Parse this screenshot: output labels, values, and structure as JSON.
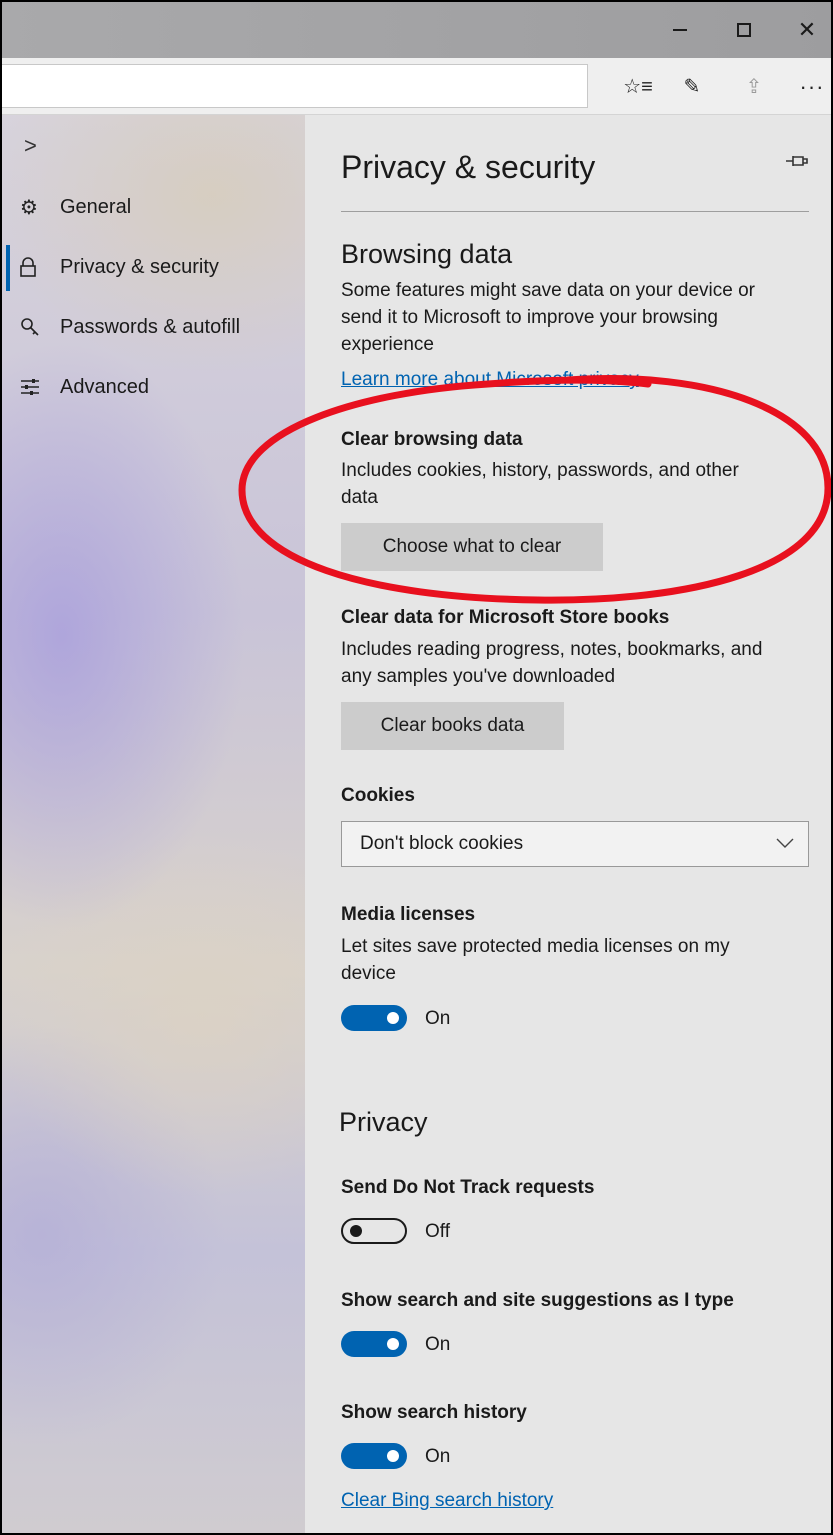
{
  "window": {
    "minimize_icon": "minimize-icon",
    "maximize_icon": "maximize-icon",
    "close_glyph": "✕"
  },
  "toolbar": {
    "favorites_glyph": "☆≡",
    "pen_glyph": "✎",
    "share_glyph": "⇪",
    "more_glyph": "···"
  },
  "sidebar": {
    "collapse_glyph": ">",
    "items": [
      {
        "label": "General",
        "icon": "gear-icon",
        "glyph": "⚙"
      },
      {
        "label": "Privacy & security",
        "icon": "lock-icon",
        "glyph": "🔒"
      },
      {
        "label": "Passwords & autofill",
        "icon": "key-icon",
        "glyph": "⚿"
      },
      {
        "label": "Advanced",
        "icon": "sliders-icon",
        "glyph": "☰"
      }
    ],
    "active_index": 1
  },
  "panel": {
    "title": "Privacy & security",
    "pin_glyph": "⊣⊏",
    "browsing_data": {
      "heading": "Browsing data",
      "description_lines": [
        "Some features might save data on your device or",
        "send it to Microsoft to improve your browsing",
        "experience"
      ],
      "learn_more_link": "Learn more about Microsoft privacy"
    },
    "clear_browsing": {
      "heading": "Clear browsing data",
      "description_lines": [
        "Includes cookies, history, passwords, and other",
        "data"
      ],
      "button": "Choose what to clear"
    },
    "clear_books": {
      "heading": "Clear data for Microsoft Store books",
      "description_lines": [
        "Includes reading progress, notes, bookmarks, and",
        "any samples you've downloaded"
      ],
      "button": "Clear books data"
    },
    "cookies": {
      "heading": "Cookies",
      "selected": "Don't block cookies",
      "chevron": "﹀"
    },
    "media_licenses": {
      "heading": "Media licenses",
      "description_lines": [
        "Let sites save protected media licenses on my",
        "device"
      ],
      "state": "On"
    },
    "privacy": {
      "heading": "Privacy",
      "dnt": {
        "label": "Send Do Not Track requests",
        "state": "Off"
      },
      "suggestions": {
        "label": "Show search and site suggestions as I type",
        "state": "On"
      },
      "history": {
        "label": "Show search history",
        "state": "On"
      },
      "clear_bing_link": "Clear Bing search history"
    }
  },
  "colors": {
    "accent": "#0063b1",
    "annotation_ring": "#e8101e",
    "panel_bg": "#e6e6e6"
  }
}
